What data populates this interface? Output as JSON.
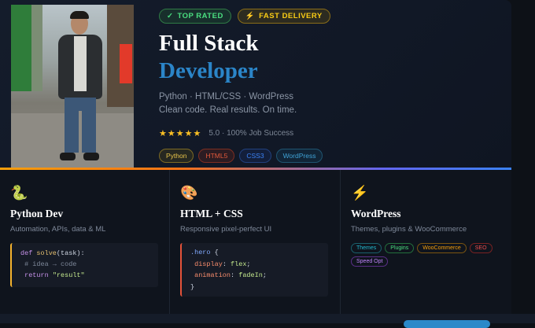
{
  "hero": {
    "badges": [
      {
        "icon": "✓",
        "label": "TOP RATED"
      },
      {
        "icon": "⚡",
        "label": "FAST DELIVERY"
      }
    ],
    "title_line1": "Full Stack",
    "title_line2": "Developer",
    "subtitle_skills": "Python · HTML/CSS · WordPress",
    "subtitle_tagline": "Clean code. Real results. On time.",
    "stars": "★★★★★",
    "rating_text": "5.0 · 100% Job Success",
    "tags": [
      "Python",
      "HTML5",
      "CSS3",
      "WordPress"
    ]
  },
  "cards": [
    {
      "icon": "🐍",
      "title": "Python Dev",
      "desc": "Automation, APIs, data & ML",
      "code": [
        {
          "kw": "def ",
          "fn": "solve",
          "tx": "(task):"
        },
        {
          "cm": " # idea → code"
        },
        {
          "kw": " return ",
          "st": "\"result\""
        }
      ]
    },
    {
      "icon": "🎨",
      "title": "HTML + CSS",
      "desc": "Responsive pixel-perfect UI",
      "code": [
        {
          "sel": ".hero",
          "tx": " {"
        },
        {
          "prop": " display",
          "tx": ": ",
          "val": "flex",
          "tx2": ";"
        },
        {
          "prop": " animation",
          "tx": ": ",
          "val": "fadeIn",
          "tx2": ";"
        },
        {
          "tx": "}"
        }
      ]
    },
    {
      "icon": "⚡",
      "title": "WordPress",
      "desc": "Themes, plugins & WooCommerce",
      "tags": [
        "Themes",
        "Plugins",
        "WooCommerce",
        "SEO",
        "Speed Opt"
      ]
    }
  ],
  "colors": {
    "accent_blue": "#2b85c8",
    "badge_green": "#4ade80",
    "badge_gold": "#facc15",
    "star": "#fbbf24",
    "background": "#0d1117"
  }
}
